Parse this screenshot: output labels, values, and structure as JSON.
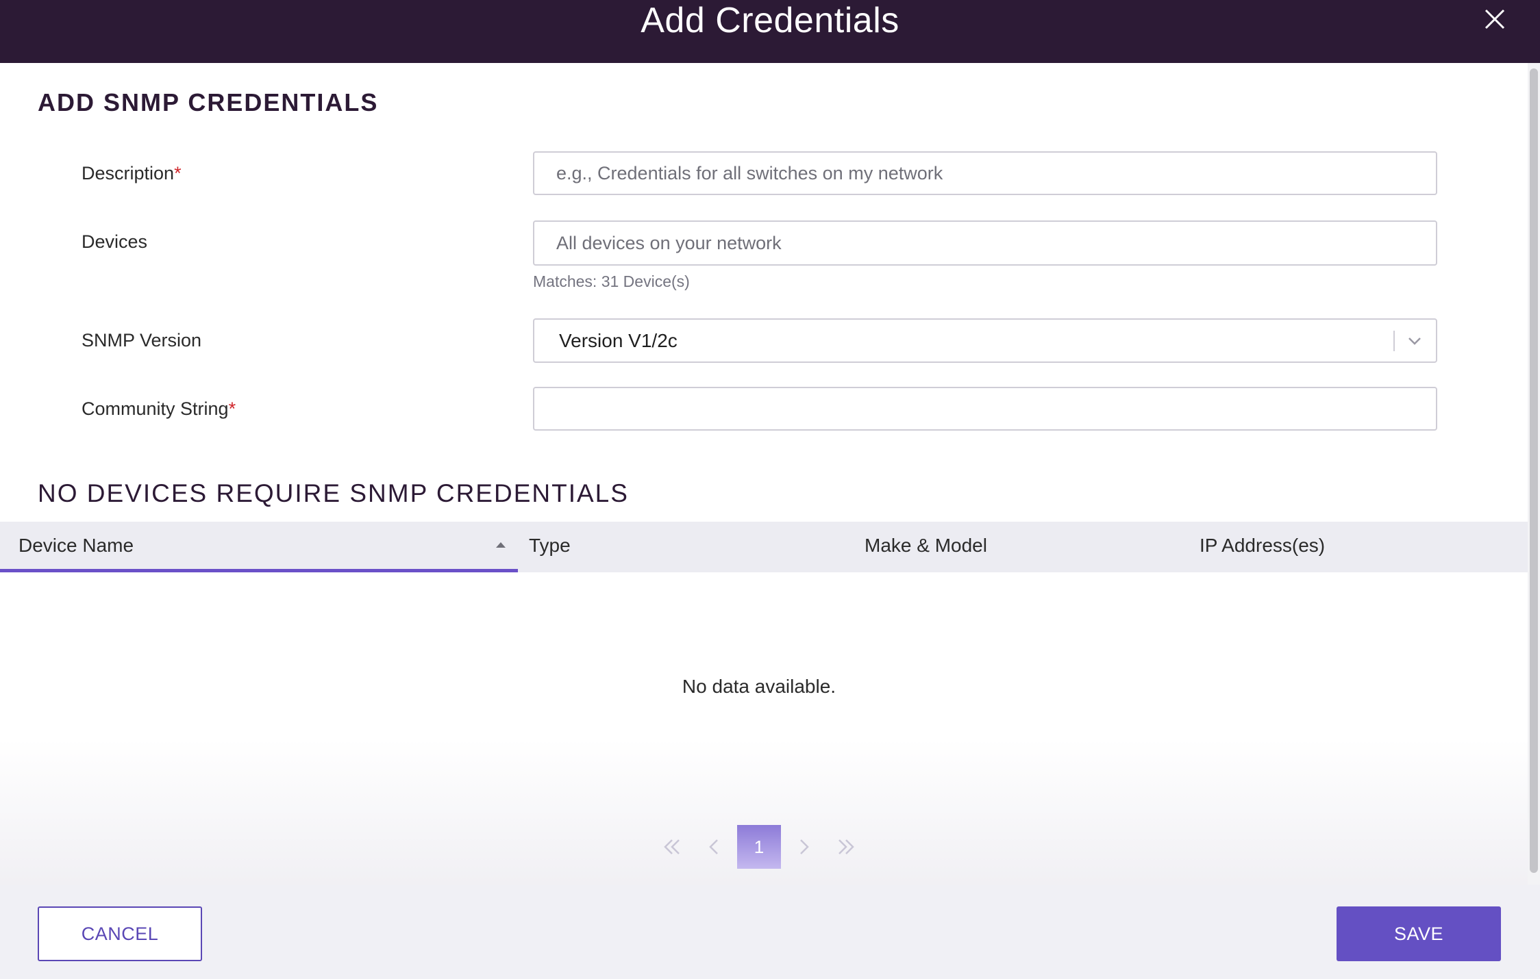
{
  "header": {
    "title": "Add Credentials",
    "close_icon": "close-icon"
  },
  "form": {
    "section_title": "ADD SNMP CREDENTIALS",
    "description": {
      "label": "Description",
      "required_mark": "*",
      "value": "",
      "placeholder": "e.g., Credentials for all switches on my network"
    },
    "devices": {
      "label": "Devices",
      "value": "",
      "placeholder": "All devices on your network",
      "matches_text": "Matches: 31 Device(s)"
    },
    "snmp_version": {
      "label": "SNMP Version",
      "selected": "Version V1/2c",
      "icon": "chevron-down-icon"
    },
    "community_string": {
      "label": "Community String",
      "required_mark": "*",
      "value": ""
    }
  },
  "device_list": {
    "title": "NO DEVICES REQUIRE SNMP CREDENTIALS",
    "columns": [
      "Device Name",
      "Type",
      "Make & Model",
      "IP Address(es)"
    ],
    "sort_icon": "sort-ascending-icon",
    "empty_message": "No data available.",
    "rows": []
  },
  "pagination": {
    "current_page": "1",
    "icons": [
      "double-chevron-left-icon",
      "chevron-left-icon",
      "chevron-right-icon",
      "double-chevron-right-icon"
    ]
  },
  "footer": {
    "cancel_label": "CANCEL",
    "save_label": "SAVE"
  },
  "colors": {
    "header_bg": "#2c1a35",
    "accent": "#6450c3",
    "required": "#d0262b"
  }
}
